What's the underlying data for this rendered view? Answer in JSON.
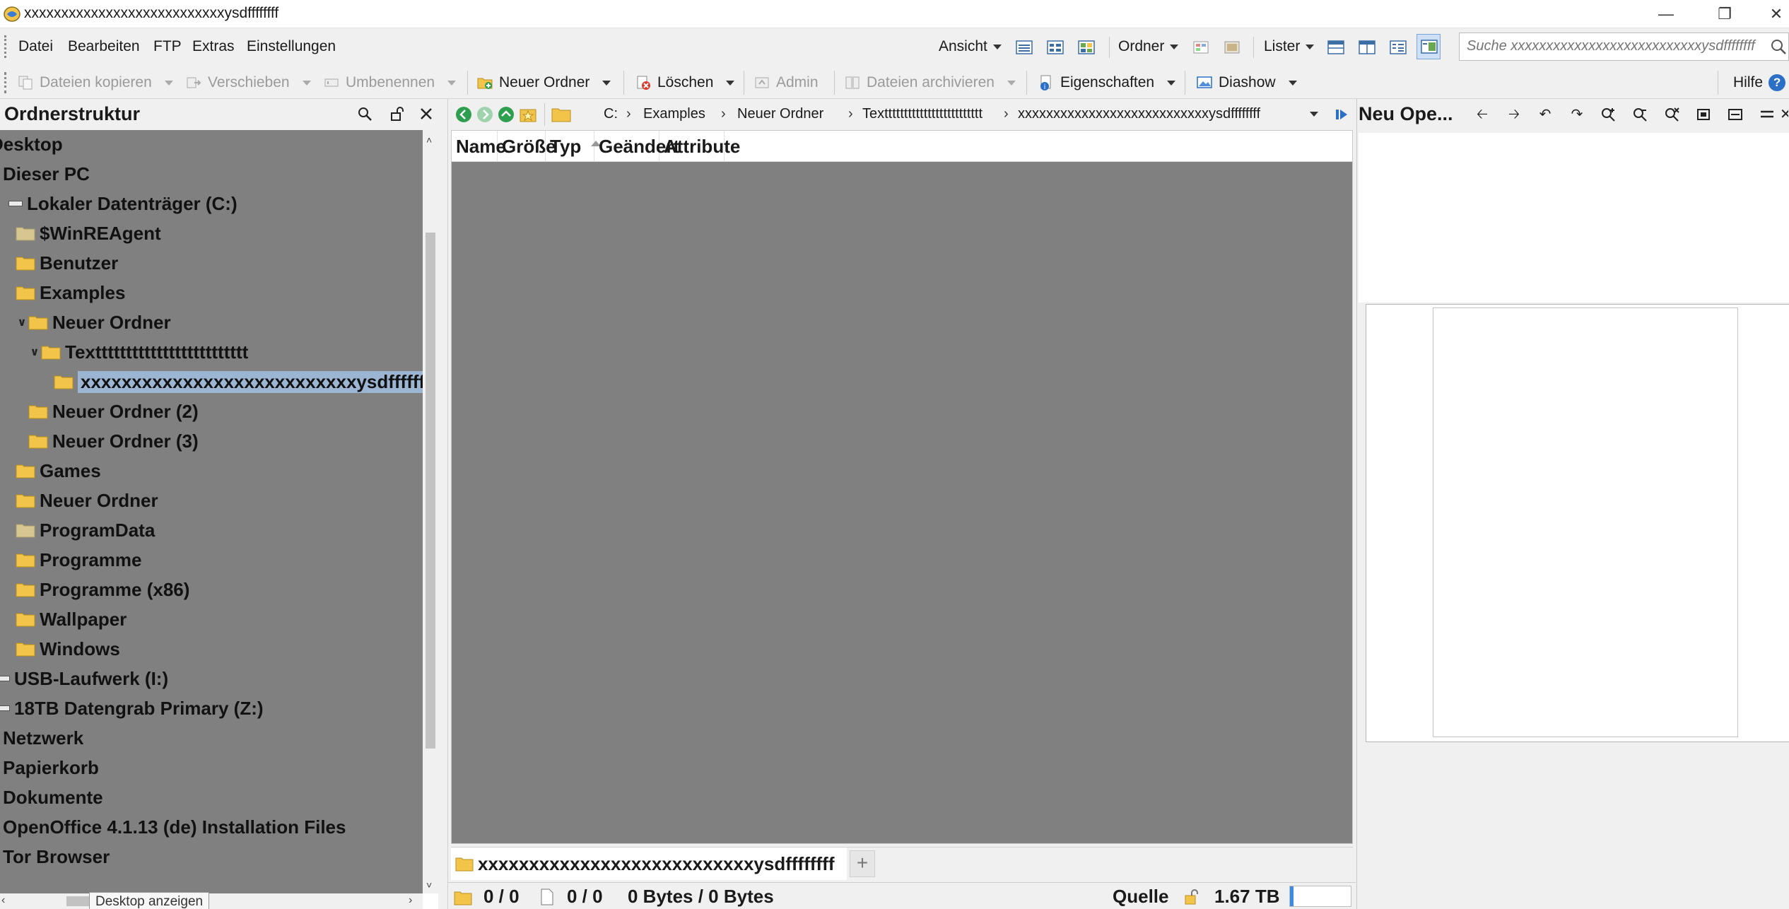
{
  "window": {
    "title": "xxxxxxxxxxxxxxxxxxxxxxxxxxxysdffffffff",
    "controls": {
      "minimize": "—",
      "restore": "❐",
      "close": "✕"
    }
  },
  "menu": {
    "items": [
      "Datei",
      "Bearbeiten",
      "FTP",
      "Extras",
      "Einstellungen"
    ],
    "right": {
      "ansicht": "Ansicht",
      "ordner": "Ordner",
      "lister": "Lister"
    }
  },
  "search": {
    "placeholder": "Suche xxxxxxxxxxxxxxxxxxxxxxxxxxxysdffffffff"
  },
  "toolbar": {
    "copy": "Dateien kopieren",
    "move": "Verschieben",
    "rename": "Umbenennen",
    "new_folder": "Neuer Ordner",
    "delete": "Löschen",
    "admin": "Admin",
    "archive": "Dateien archivieren",
    "properties": "Eigenschaften",
    "slideshow": "Diashow",
    "help": "Hilfe",
    "help_glyph": "?"
  },
  "folder_tree": {
    "title": "Ordnerstruktur",
    "items": [
      {
        "label": "Desktop",
        "indent": 0,
        "icon": "none"
      },
      {
        "label": "Dieser PC",
        "indent": 0,
        "icon": "none"
      },
      {
        "label": "Lokaler Datenträger (C:)",
        "indent": 0,
        "icon": "drive",
        "expander": "collapse"
      },
      {
        "label": "$WinREAgent",
        "indent": 1,
        "icon": "folder-gray"
      },
      {
        "label": "Benutzer",
        "indent": 1,
        "icon": "folder"
      },
      {
        "label": "Examples",
        "indent": 1,
        "icon": "folder"
      },
      {
        "label": "Neuer Ordner",
        "indent": 2,
        "icon": "folder",
        "expander": "v"
      },
      {
        "label": "Texttttttttttttttttttttttttt",
        "indent": 3,
        "icon": "folder",
        "expander": "v"
      },
      {
        "label": "xxxxxxxxxxxxxxxxxxxxxxxxxxxysdffffffff",
        "indent": 4,
        "icon": "folder",
        "selected": true
      },
      {
        "label": "Neuer Ordner (2)",
        "indent": 2,
        "icon": "folder"
      },
      {
        "label": "Neuer Ordner (3)",
        "indent": 2,
        "icon": "folder"
      },
      {
        "label": "Games",
        "indent": 1,
        "icon": "folder"
      },
      {
        "label": "Neuer Ordner",
        "indent": 1,
        "icon": "folder"
      },
      {
        "label": "ProgramData",
        "indent": 1,
        "icon": "folder-gray"
      },
      {
        "label": "Programme",
        "indent": 1,
        "icon": "folder"
      },
      {
        "label": "Programme (x86)",
        "indent": 1,
        "icon": "folder"
      },
      {
        "label": "Wallpaper",
        "indent": 1,
        "icon": "folder"
      },
      {
        "label": "Windows",
        "indent": 1,
        "icon": "folder"
      },
      {
        "label": "USB-Laufwerk (I:)",
        "indent": 0,
        "icon": "drive"
      },
      {
        "label": "18TB Datengrab Primary (Z:)",
        "indent": 0,
        "icon": "drive"
      },
      {
        "label": "Netzwerk",
        "indent": 0,
        "icon": "none"
      },
      {
        "label": "Papierkorb",
        "indent": 0,
        "icon": "none"
      },
      {
        "label": "Dokumente",
        "indent": 0,
        "icon": "none"
      },
      {
        "label": "OpenOffice 4.1.13 (de) Installation Files",
        "indent": 0,
        "icon": "none"
      },
      {
        "label": "Tor Browser",
        "indent": 0,
        "icon": "none"
      }
    ]
  },
  "address": {
    "segments": [
      "C:",
      "Examples",
      "Neuer Ordner",
      "Texttttttttttttttttttttttttt",
      "xxxxxxxxxxxxxxxxxxxxxxxxxxxysdffffffff"
    ]
  },
  "file_list": {
    "columns": [
      {
        "label": "Name",
        "sorted": false
      },
      {
        "label": "Größe",
        "sorted": false
      },
      {
        "label": "Typ",
        "sorted": true
      },
      {
        "label": "Geändert",
        "sorted": false
      },
      {
        "label": "Attribute",
        "sorted": false
      }
    ],
    "rows": []
  },
  "tabs": {
    "active": "xxxxxxxxxxxxxxxxxxxxxxxxxxxysdffffffff",
    "add": "+"
  },
  "status": {
    "folders": "0 / 0",
    "files": "0 / 0",
    "bytes": "0 Bytes / 0 Bytes",
    "source": "Quelle",
    "free_space": "1.67 TB"
  },
  "preview": {
    "title": "Neu Ope..."
  },
  "tooltip": "Desktop anzeigen",
  "colors": {
    "pane_gray": "#808080",
    "selection": "#9bb5d3",
    "folder_yellow": "#f2c44a",
    "nav_green": "#2e9e4f"
  }
}
